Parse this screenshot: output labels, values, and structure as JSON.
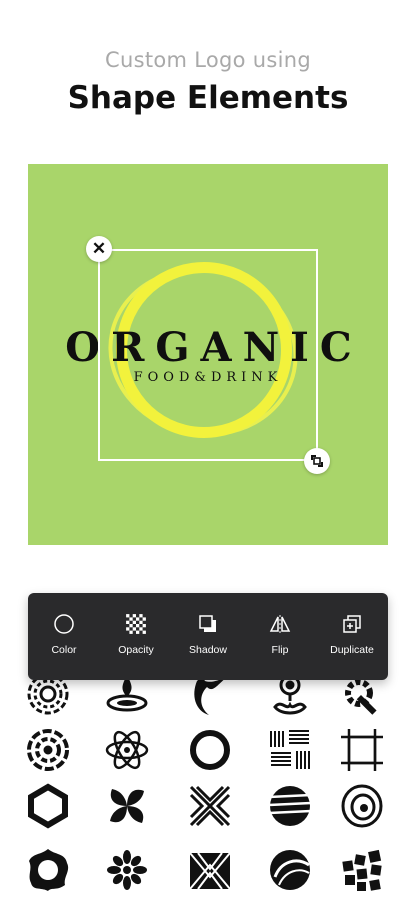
{
  "header": {
    "subtitle": "Custom Logo using",
    "title": "Shape Elements"
  },
  "canvas": {
    "background_color": "#a9d56a",
    "accent_color": "#f2f23c",
    "logo_main_text": "ORGANIC",
    "logo_sub_text": "FOOD&DRINK"
  },
  "toolbar": {
    "items": [
      {
        "label": "Color",
        "icon": "circle-outline-icon"
      },
      {
        "label": "Opacity",
        "icon": "checkerboard-icon"
      },
      {
        "label": "Shadow",
        "icon": "shadow-squares-icon"
      },
      {
        "label": "Flip",
        "icon": "flip-icon"
      },
      {
        "label": "Duplicate",
        "icon": "duplicate-icon"
      }
    ]
  },
  "shapes": [
    "spiral-burst-icon",
    "water-drop-ripple-icon",
    "swoosh-leaf-icon",
    "meditation-figure-icon",
    "gear-wrench-icon",
    "concentric-dashed-circles-icon",
    "atom-icon",
    "brush-ring-icon",
    "line-pattern-icon",
    "square-frame-icon",
    "hexagon-knot-icon",
    "pinwheel-icon",
    "cross-chevron-icon",
    "striped-globe-icon",
    "tree-ring-icon",
    "blob-ring-icon",
    "dotted-flower-icon",
    "zigzag-lines-icon",
    "swirl-sphere-icon",
    "scattered-squares-icon"
  ]
}
